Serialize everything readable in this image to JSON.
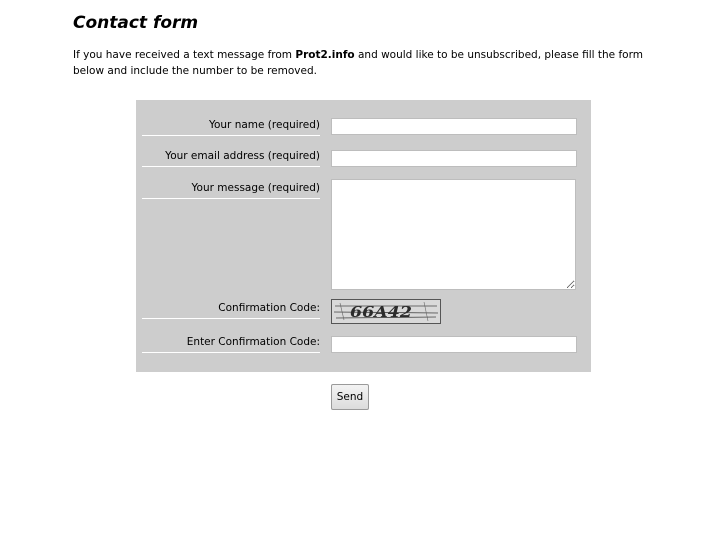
{
  "page": {
    "title": "Contact form",
    "intro_before": "If you have received a text message from ",
    "intro_brand": "Prot2.info",
    "intro_after": " and would like to be unsubscribed, please fill the form below and include the number to be removed."
  },
  "form": {
    "name_label": "Your name (required)",
    "name_value": "",
    "email_label": "Your email address (required)",
    "email_value": "",
    "message_label": "Your message (required)",
    "message_value": "",
    "captcha_label": "Confirmation Code:",
    "captcha_text": "66A42",
    "code_label": "Enter Confirmation Code:",
    "code_value": "",
    "send_label": "Send"
  }
}
